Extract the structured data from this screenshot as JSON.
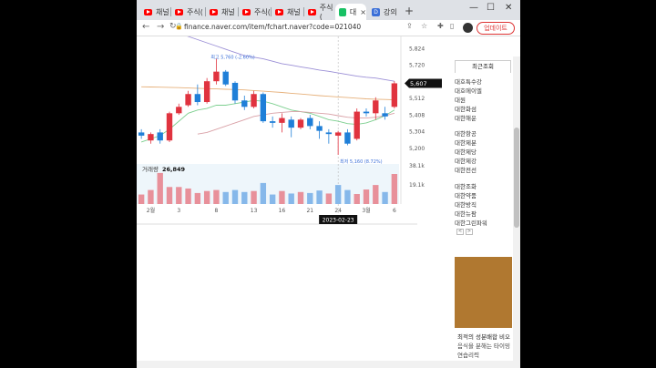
{
  "browser": {
    "tabs": [
      {
        "label": "채널",
        "icon": "youtube-icon"
      },
      {
        "label": "주식(",
        "icon": "youtube-icon"
      },
      {
        "label": "채널",
        "icon": "youtube-icon"
      },
      {
        "label": "주식(",
        "icon": "youtube-icon"
      },
      {
        "label": "채널",
        "icon": "youtube-icon"
      },
      {
        "label": "주식(",
        "icon": "youtube-icon"
      },
      {
        "label": "대",
        "icon": "naver-icon",
        "active": true,
        "close": "×"
      },
      {
        "label": "강의",
        "icon": "doc-icon"
      }
    ],
    "new_tab": "+",
    "url": "finance.naver.com/item/fchart.naver?code=021040",
    "update_label": "업데이트",
    "accent": "#d33"
  },
  "chart_data": {
    "type": "candlestick",
    "x_tick_labels": [
      "2월",
      "3",
      "8",
      "13",
      "16",
      "21",
      "24",
      "3월",
      "6"
    ],
    "y_tick_labels": [
      "5,824",
      "5,720",
      "5,616",
      "5,512",
      "5,408",
      "5,304",
      "5,200"
    ],
    "current_price_label": "5,607",
    "ylim": [
      5160,
      5900
    ],
    "max_annotation": "최고 5,760 (-2.60%)",
    "min_annotation": "최저 5,160 (8.72%)",
    "crosshair_date": "2023-02-23",
    "candles": [
      {
        "o": 5300,
        "h": 5320,
        "l": 5260,
        "c": 5280
      },
      {
        "o": 5250,
        "h": 5300,
        "l": 5230,
        "c": 5290
      },
      {
        "o": 5300,
        "h": 5320,
        "l": 5230,
        "c": 5250
      },
      {
        "o": 5250,
        "h": 5430,
        "l": 5240,
        "c": 5420
      },
      {
        "o": 5420,
        "h": 5480,
        "l": 5410,
        "c": 5460
      },
      {
        "o": 5470,
        "h": 5560,
        "l": 5460,
        "c": 5540
      },
      {
        "o": 5540,
        "h": 5600,
        "l": 5470,
        "c": 5490
      },
      {
        "o": 5490,
        "h": 5640,
        "l": 5480,
        "c": 5620
      },
      {
        "o": 5620,
        "h": 5760,
        "l": 5600,
        "c": 5680
      },
      {
        "o": 5680,
        "h": 5690,
        "l": 5590,
        "c": 5600
      },
      {
        "o": 5610,
        "h": 5620,
        "l": 5480,
        "c": 5500
      },
      {
        "o": 5500,
        "h": 5530,
        "l": 5440,
        "c": 5460
      },
      {
        "o": 5460,
        "h": 5560,
        "l": 5450,
        "c": 5540
      },
      {
        "o": 5540,
        "h": 5550,
        "l": 5360,
        "c": 5370
      },
      {
        "o": 5370,
        "h": 5400,
        "l": 5330,
        "c": 5360
      },
      {
        "o": 5360,
        "h": 5420,
        "l": 5300,
        "c": 5390
      },
      {
        "o": 5380,
        "h": 5400,
        "l": 5270,
        "c": 5330
      },
      {
        "o": 5330,
        "h": 5390,
        "l": 5320,
        "c": 5380
      },
      {
        "o": 5390,
        "h": 5410,
        "l": 5320,
        "c": 5340
      },
      {
        "o": 5340,
        "h": 5370,
        "l": 5260,
        "c": 5310
      },
      {
        "o": 5300,
        "h": 5320,
        "l": 5230,
        "c": 5290
      },
      {
        "o": 5280,
        "h": 5310,
        "l": 5160,
        "c": 5300
      },
      {
        "o": 5300,
        "h": 5320,
        "l": 5220,
        "c": 5230
      },
      {
        "o": 5260,
        "h": 5450,
        "l": 5250,
        "c": 5430
      },
      {
        "o": 5430,
        "h": 5450,
        "l": 5400,
        "c": 5420
      },
      {
        "o": 5420,
        "h": 5520,
        "l": 5380,
        "c": 5500
      },
      {
        "o": 5420,
        "h": 5460,
        "l": 5380,
        "c": 5400
      },
      {
        "o": 5460,
        "h": 5620,
        "l": 5450,
        "c": 5607
      }
    ],
    "ma_lines": [
      {
        "color": "#9b8fd6",
        "values": [
          6000,
          5980,
          5960,
          5940,
          5920,
          5900,
          5880,
          5860,
          5840,
          5820,
          5800,
          5780,
          5770,
          5760,
          5745,
          5730,
          5720,
          5710,
          5700,
          5690,
          5682,
          5672,
          5662,
          5652,
          5645,
          5640,
          5630,
          5620
        ]
      },
      {
        "color": "#e6b07a",
        "values": [
          5585,
          5584,
          5583,
          5582,
          5580,
          5578,
          5576,
          5574,
          5572,
          5570,
          5568,
          5566,
          5562,
          5558,
          5554,
          5550,
          5545,
          5540,
          5535,
          5530,
          5526,
          5522,
          5518,
          5514,
          5510,
          5508,
          5506,
          5504
        ]
      },
      {
        "color": "#7ccf8f",
        "values": [
          5240,
          5260,
          5280,
          5320,
          5370,
          5420,
          5440,
          5450,
          5470,
          5470,
          5480,
          5490,
          5500,
          5495,
          5480,
          5460,
          5440,
          5430,
          5420,
          5400,
          5380,
          5370,
          5355,
          5350,
          5360,
          5380,
          5405,
          5440
        ]
      },
      {
        "color": "#d9a0a6",
        "values": [
          null,
          null,
          null,
          null,
          null,
          null,
          5290,
          5300,
          5320,
          5340,
          5360,
          5380,
          5400,
          5410,
          5420,
          5425,
          5430,
          5430,
          5425,
          5420,
          5415,
          5405,
          5395,
          5390,
          5390,
          5395,
          5405,
          5420
        ]
      }
    ],
    "volume": {
      "label": "거래량",
      "value_label": "26,849",
      "y_tick_labels": [
        "38.1k",
        "19.1k"
      ],
      "ylim": [
        0,
        40000
      ],
      "values": [
        9500,
        14000,
        31000,
        17000,
        17000,
        15500,
        11000,
        13000,
        14000,
        12000,
        14000,
        12000,
        13000,
        21000,
        9500,
        13000,
        10500,
        12000,
        11000,
        13500,
        10500,
        19000,
        14000,
        10000,
        14500,
        19000,
        12000,
        30000
      ],
      "colors": [
        "up",
        "up",
        "up",
        "up",
        "up",
        "up",
        "up",
        "up",
        "up",
        "down",
        "down",
        "down",
        "up",
        "down",
        "down",
        "up",
        "down",
        "up",
        "down",
        "down",
        "up",
        "down",
        "down",
        "up",
        "up",
        "up",
        "down",
        "up"
      ]
    },
    "up_color": "#e0333f",
    "down_color": "#1f7fd8"
  },
  "right_panel": {
    "tab_label": "최근조회",
    "items": [
      "대호특수강",
      "대호에이엘",
      "대원",
      "대한화섬",
      "대한해운",
      "대한항공",
      "대한제분",
      "대한제당",
      "대한제강",
      "대한전선",
      "대한조화",
      "대한약품",
      "대한방직",
      "대한뉴팜",
      "대한그린파워"
    ],
    "page_prev": "<",
    "page_next": ">",
    "ad_title": "최적의 성분배합 비오",
    "ad_sub": "음식을 분해는 타이밍",
    "ad_source": "연습리력"
  }
}
